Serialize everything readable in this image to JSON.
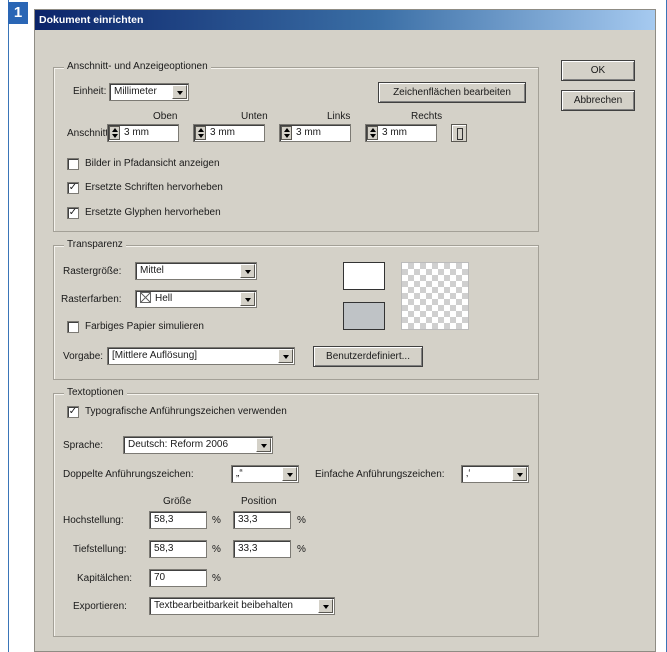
{
  "figure_number": "1",
  "window": {
    "title": "Dokument einrichten"
  },
  "buttons": {
    "ok": "OK",
    "cancel": "Abbrechen"
  },
  "anschnitt_group": {
    "legend": "Anschnitt- und Anzeigeoptionen",
    "einheit_label": "Einheit:",
    "einheit_value": "Millimeter",
    "edit_artboards_button": "Zeichenflächen bearbeiten",
    "col_headers": {
      "top": "Oben",
      "bottom": "Unten",
      "left": "Links",
      "right": "Rechts"
    },
    "anschnitt_label": "Anschnitt:",
    "values": {
      "top": "3 mm",
      "bottom": "3 mm",
      "left": "3 mm",
      "right": "3 mm"
    },
    "checkboxes": [
      {
        "label": "Bilder in Pfadansicht anzeigen",
        "checked": false
      },
      {
        "label": "Ersetzte Schriften hervorheben",
        "checked": true
      },
      {
        "label": "Ersetzte Glyphen hervorheben",
        "checked": true
      }
    ]
  },
  "transparency_group": {
    "legend": "Transparenz",
    "rastergroesse_label": "Rastergröße:",
    "rastergroesse_value": "Mittel",
    "rasterfarben_label": "Rasterfarben:",
    "rasterfarben_value": "Hell",
    "paper_checkbox": {
      "label": "Farbiges Papier simulieren",
      "checked": false
    },
    "vorgabe_label": "Vorgabe:",
    "vorgabe_value": "[Mittlere Auflösung]",
    "custom_button": "Benutzerdefiniert..."
  },
  "text_group": {
    "legend": "Textoptionen",
    "quotes_checkbox": {
      "label": "Typografische Anführungszeichen verwenden",
      "checked": true
    },
    "sprache_label": "Sprache:",
    "sprache_value": "Deutsch: Reform 2006",
    "double_quotes_label": "Doppelte Anführungszeichen:",
    "double_quotes_value": "„“",
    "single_quotes_label": "Einfache Anführungszeichen:",
    "single_quotes_value": "‚‘",
    "size_header": "Größe",
    "position_header": "Position",
    "superscript_label": "Hochstellung:",
    "superscript_size": "58,3",
    "superscript_position": "33,3",
    "subscript_label": "Tiefstellung:",
    "subscript_size": "58,3",
    "subscript_position": "33,3",
    "smallcaps_label": "Kapitälchen:",
    "smallcaps_value": "70",
    "percent": "%",
    "export_label": "Exportieren:",
    "export_value": "Textbearbeitbarkeit beibehalten"
  }
}
